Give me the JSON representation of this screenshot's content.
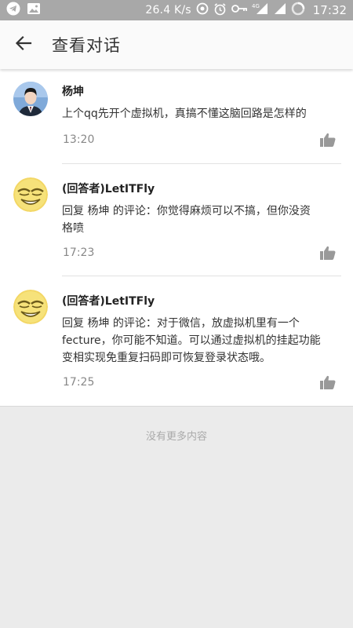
{
  "status_bar": {
    "speed": "26.4 K/s",
    "network": "4G",
    "time": "17:32"
  },
  "header": {
    "title": "查看对话"
  },
  "comments": [
    {
      "author": "杨坤",
      "text": "上个qq先开个虚拟机，真搞不懂这脑回路是怎样的",
      "time": "13:20"
    },
    {
      "author": "(回答者)LetITFly",
      "text": "回复 杨坤 的评论：你觉得麻烦可以不搞，但你没资格喷",
      "time": "17:23"
    },
    {
      "author": "(回答者)LetITFly",
      "text": "回复 杨坤 的评论：对于微信，放虚拟机里有一个fecture，你可能不知道。可以通过虚拟机的挂起功能变相实现免重复扫码即可恢复登录状态哦。",
      "time": "17:25"
    }
  ],
  "footer": {
    "no_more": "没有更多内容"
  },
  "colors": {
    "status_bar": "#a8a8a8",
    "app_bar": "#fafafa",
    "background": "#ebebeb"
  }
}
